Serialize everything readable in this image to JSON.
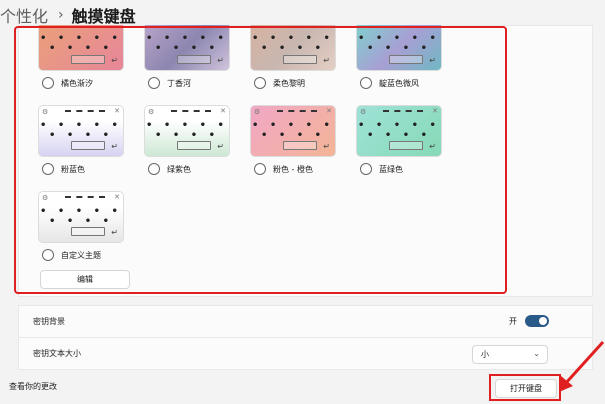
{
  "breadcrumb": {
    "parent": "个性化",
    "separator": "›",
    "current": "触摸键盘"
  },
  "themes": [
    {
      "label": "橘色渐汐",
      "bg": "linear-gradient(135deg,#e9a07a,#e8869a)",
      "cut": true
    },
    {
      "label": "丁香河",
      "bg": "linear-gradient(135deg,#b8a3c8,#8c86b0,#d0c4dc)",
      "cut": true
    },
    {
      "label": "柔色黎明",
      "bg": "linear-gradient(135deg,#d7b2a0,#c8b6b0,#e4cfc4)",
      "cut": true
    },
    {
      "label": "靛蓝色微风",
      "bg": "linear-gradient(135deg,#7fd0cc,#a89fd4,#6fb8c4)",
      "cut": true
    },
    {
      "label": "粉蓝色",
      "bg": "linear-gradient(180deg,#ffffff 30%,#d6d2f2)",
      "cut": false
    },
    {
      "label": "绿紫色",
      "bg": "linear-gradient(180deg,#ffffff 30%,#cde8d4)",
      "cut": false
    },
    {
      "label": "粉色 - 橙色",
      "bg": "linear-gradient(135deg,#f0a7c6,#f3b596)",
      "cut": false
    },
    {
      "label": "蓝绿色",
      "bg": "linear-gradient(135deg,#9fe2d8,#86d9b6)",
      "cut": false
    },
    {
      "label": "自定义主题",
      "bg": "linear-gradient(180deg,#ffffff 30%,#e6e6e6)",
      "cut": false
    }
  ],
  "thumb": {
    "keys_row1": "• • • • •",
    "keys_row2": "• • • •",
    "enter": "↵",
    "gear": "⚙",
    "close": "✕"
  },
  "edit_button": "编辑",
  "key_background": {
    "label": "密钥背景",
    "state": "开"
  },
  "key_text_size": {
    "label": "密钥文本大小",
    "value": "小",
    "chevron": "⌄"
  },
  "footer": {
    "label": "查看你的更改",
    "button": "打开键盘"
  }
}
